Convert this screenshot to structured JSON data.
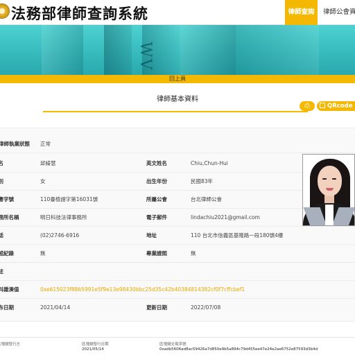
{
  "header": {
    "site_title": "法務部律師查詢系統",
    "nav_active": "律師查詢",
    "nav_next": "律師公會資訊"
  },
  "back_label": "回上頁",
  "section_title": "律師基本資料",
  "buttons": {
    "print": "⎙",
    "qrcode": "QRcode"
  },
  "status_row": {
    "label": "律師執業狀態",
    "value": "正常"
  },
  "rows": [
    {
      "label": "姓名",
      "value": "邱綺慧",
      "label2": "英文姓名",
      "value2": "Chiu,Chun-Hui"
    },
    {
      "label": "性別",
      "value": "女",
      "label2": "出生年份",
      "value2": "民國83年"
    },
    {
      "label": "證書字號",
      "value": "110臺檢證字第16031號",
      "label2": "所屬公會",
      "value2": "台北律師公會"
    },
    {
      "label": "事務所名稱",
      "value": "明日科技法律事務所",
      "label2": "電子郵件",
      "value2": "lindachiu2021@gmail.com"
    },
    {
      "label": "電話",
      "value": "(02)2746-6916",
      "label2": "地址",
      "value2": "110 台北市信義區基隆路一段180號4樓"
    },
    {
      "label": "懲戒紀錄",
      "value": "無",
      "label2": "專業證照",
      "value2": "無"
    },
    {
      "label": "備註",
      "value": ""
    },
    {
      "label": "資料雜湊值",
      "value": "0xe615023f8865991e5f9e13e98430bbc25d35c42b40384814382cf0f7cffcbef1"
    },
    {
      "label": "發布日期",
      "value": "2021/04/14",
      "label2": "更新日期",
      "value2": "2022/07/08"
    }
  ],
  "footer": {
    "col1_label": "區塊鏈發行方",
    "col2_label": "區塊鏈發行日期",
    "col2_value": "2021/05/14",
    "col3_label": "區塊鏈交易序號",
    "col3_value": "0xadb5606ad8ac59426a7d850e9b5a894c79d455ee47e24e2ae6752e87593d3b4d"
  },
  "colors": {
    "accent": "#f5b800",
    "banner": "#3bbfc0",
    "hash": "#e6a700"
  },
  "icons": {
    "logo": "seal-logo-icon",
    "print": "print-icon",
    "qr": "qrcode-icon"
  }
}
